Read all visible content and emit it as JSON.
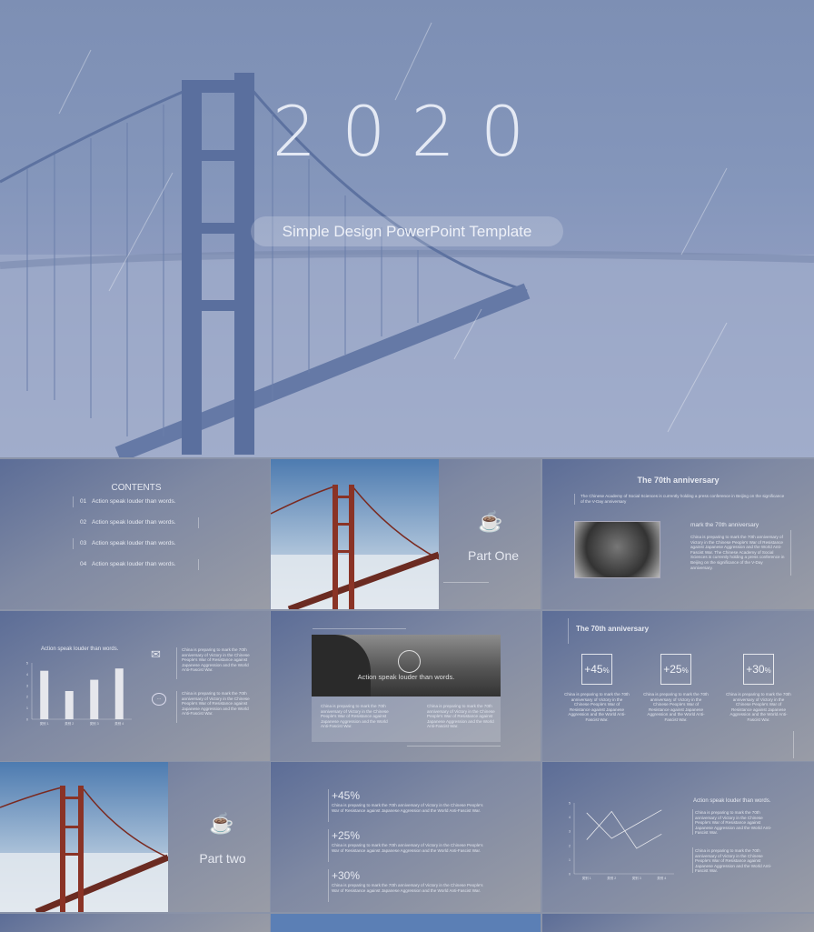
{
  "hero": {
    "year": "2020",
    "subtitle": "Simple Design PowerPoint Template"
  },
  "contents": {
    "title": "CONTENTS",
    "items": [
      {
        "num": "01",
        "label": "Action speak louder than words."
      },
      {
        "num": "02",
        "label": "Action speak louder than words."
      },
      {
        "num": "03",
        "label": "Action speak louder than words."
      },
      {
        "num": "04",
        "label": "Action speak louder than words."
      }
    ]
  },
  "part_one": {
    "label": "Part One",
    "icon": "coffee-cup-icon"
  },
  "part_two": {
    "label": "Part two",
    "icon": "coffee-cup-icon"
  },
  "anniv1": {
    "title": "The 70th anniversary",
    "intro": "The Chinese Academy of Social Sciences is currently holding a press conference in Beijing on the significance of the V-Day anniversary",
    "subtitle": "mark the 70th anniversary",
    "body": "China is preparing to mark the 70th anniversary of Victory in the Chinese People's War of Resistance against Japanese Aggression and the World Anti-Fascist War. The Chinese Academy of Social Sciences is currently holding a press conference in Beijing on the significance of the V-Day anniversary."
  },
  "bar_slide": {
    "title": "Action speak louder than words.",
    "text1": "China is preparing to mark the 70th anniversary of Victory in the Chinese People's War of Resistance against Japanese Aggression and the World Anti-Fascist War.",
    "text2": "China is preparing to mark the 70th anniversary of Victory in the Chinese People's War of Resistance against Japanese Aggression and the World Anti-Fascist War.",
    "icon1": "mail-icon",
    "icon2": "chat-bubble-icon"
  },
  "photo_slide": {
    "caption": "Action speak louder than words.",
    "icon": "clock-icon",
    "text1": "China is preparing to mark the 70th anniversary of Victory in the Chinese People's War of Resistance against Japanese Aggression and the World Anti-Fascist War.",
    "text2": "China is preparing to mark the 70th anniversary of Victory in the Chinese People's War of Resistance against Japanese Aggression and the World Anti-Fascist War."
  },
  "anniv2": {
    "title": "The 70th anniversary",
    "stats": [
      {
        "value": "+45",
        "unit": "%",
        "text": "China is preparing to mark the 70th anniversary of Victory in the Chinese People's War of Resistance against Japanese Aggression and the World Anti-Fascist War."
      },
      {
        "value": "+25",
        "unit": "%",
        "text": "China is preparing to mark the 70th anniversary of Victory in the Chinese People's War of Resistance against Japanese Aggression and the World Anti-Fascist War."
      },
      {
        "value": "+30",
        "unit": "%",
        "text": "China is preparing to mark the 70th anniversary of Victory in the Chinese People's War of Resistance against Japanese Aggression and the World Anti-Fascist War."
      }
    ]
  },
  "stats_list": [
    {
      "value": "+45%",
      "text": "China is preparing to mark the 70th anniversary of Victory in the Chinese People's War of Resistance against Japanese Aggression and the World Anti-Fascist War."
    },
    {
      "value": "+25%",
      "text": "China is preparing to mark the 70th anniversary of Victory in the Chinese People's War of Resistance against Japanese Aggression and the World Anti-Fascist War."
    },
    {
      "value": "+30%",
      "text": "China is preparing to mark the 70th anniversary of Victory in the Chinese People's War of Resistance against Japanese Aggression and the World Anti-Fascist War."
    }
  ],
  "line_slide": {
    "title": "Action speak louder than words.",
    "text1": "China is preparing to mark the 70th anniversary of Victory in the Chinese People's War of Resistance against Japanese Aggression and the World Anti-Fascist War.",
    "text2": "China is preparing to mark the 70th anniversary of Victory in the Chinese People's War of Resistance against Japanese Aggression and the World Anti-Fascist War."
  },
  "chart_data": [
    {
      "type": "bar",
      "title": "Action speak louder than words.",
      "categories": [
        "类别 1",
        "类别 2",
        "类别 3",
        "类别 4"
      ],
      "values": [
        4.3,
        2.5,
        3.5,
        4.5
      ],
      "ylim": [
        0,
        5
      ],
      "yticks": [
        0,
        1,
        2,
        3,
        4,
        5
      ],
      "color": "#e6e7ec"
    },
    {
      "type": "line",
      "categories": [
        "类别 1",
        "类别 2",
        "类别 3",
        "类别 4"
      ],
      "series": [
        {
          "values": [
            4.3,
            2.5,
            3.5,
            4.5
          ]
        },
        {
          "values": [
            2.4,
            4.4,
            1.8,
            2.8
          ]
        }
      ],
      "ylim": [
        0,
        5
      ],
      "yticks": [
        0,
        1,
        2,
        3,
        4,
        5
      ],
      "color": "#e6e7ec"
    }
  ],
  "colors": {
    "hero_bg": "#8496bb",
    "slide_bg": "#7f89a3",
    "text": "#e6e9f1"
  }
}
